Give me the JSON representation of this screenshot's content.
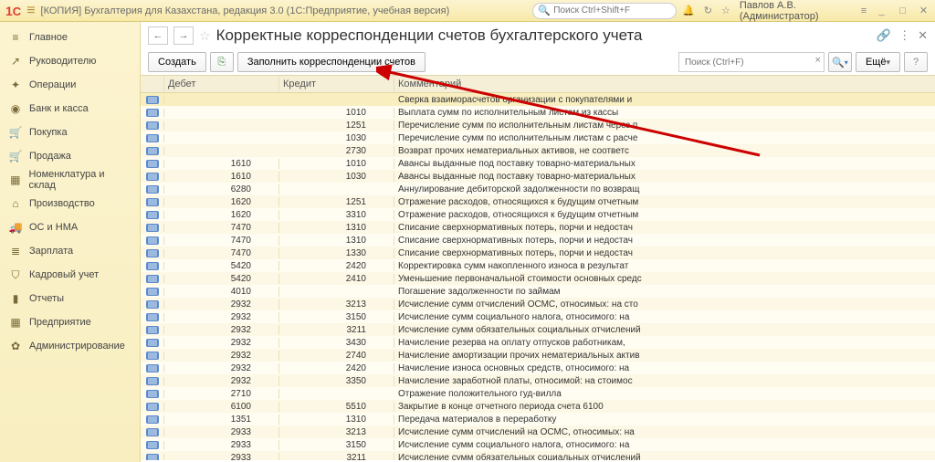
{
  "app_title": "[КОПИЯ] Бухгалтерия для Казахстана, редакция 3.0  (1С:Предприятие, учебная версия)",
  "top_search_placeholder": "Поиск Ctrl+Shift+F",
  "user": "Павлов А.В. (Администратор)",
  "sidebar": {
    "items": [
      {
        "icon": "≡",
        "label": "Главное"
      },
      {
        "icon": "↗",
        "label": "Руководителю"
      },
      {
        "icon": "✦",
        "label": "Операции"
      },
      {
        "icon": "◉",
        "label": "Банк и касса"
      },
      {
        "icon": "🛒",
        "label": "Покупка"
      },
      {
        "icon": "🛒",
        "label": "Продажа"
      },
      {
        "icon": "▦",
        "label": "Номенклатура и склад"
      },
      {
        "icon": "⌂",
        "label": "Производство"
      },
      {
        "icon": "🚚",
        "label": "ОС и НМА"
      },
      {
        "icon": "≣",
        "label": "Зарплата"
      },
      {
        "icon": "⛉",
        "label": "Кадровый учет"
      },
      {
        "icon": "▮",
        "label": "Отчеты"
      },
      {
        "icon": "▦",
        "label": "Предприятие"
      },
      {
        "icon": "✿",
        "label": "Администрирование"
      }
    ]
  },
  "page_title": "Корректные корреспонденции счетов бухгалтерского учета",
  "toolbar": {
    "create": "Создать",
    "fill": "Заполнить корреспонденции счетов",
    "search_placeholder": "Поиск (Ctrl+F)",
    "more": "Ещё"
  },
  "columns": {
    "debet": "Дебет",
    "credit": "Кредит",
    "comment": "Комментарий"
  },
  "rows": [
    {
      "d": "",
      "c": "",
      "m": "Сверка взаиморасчетов организации с покупателями и",
      "sel": true
    },
    {
      "d": "",
      "c": "1010",
      "m": "Выплата сумм по исполнительным листам из кассы"
    },
    {
      "d": "",
      "c": "1251",
      "m": "Перечисление сумм по исполнительным листам через п"
    },
    {
      "d": "",
      "c": "1030",
      "m": "Перечисление сумм по исполнительным листам с расче"
    },
    {
      "d": "",
      "c": "2730",
      "m": "Возврат прочих нематериальных активов, не соответс"
    },
    {
      "d": "1610",
      "c": "1010",
      "m": "Авансы выданные под поставку товарно-материальных"
    },
    {
      "d": "1610",
      "c": "1030",
      "m": "Авансы выданные под поставку товарно-материальных"
    },
    {
      "d": "6280",
      "c": "",
      "m": "Аннулирование дебиторской задолженности по возвращ"
    },
    {
      "d": "1620",
      "c": "1251",
      "m": "Отражение расходов, относящихся к будущим отчетным"
    },
    {
      "d": "1620",
      "c": "3310",
      "m": "Отражение расходов, относящихся к будущим отчетным"
    },
    {
      "d": "7470",
      "c": "1310",
      "m": "Списание сверхнормативных потерь, порчи и недостач"
    },
    {
      "d": "7470",
      "c": "1310",
      "m": "Списание сверхнормативных потерь, порчи и недостач"
    },
    {
      "d": "7470",
      "c": "1330",
      "m": "Списание сверхнормативных потерь, порчи и недостач"
    },
    {
      "d": "5420",
      "c": "2420",
      "m": "Корректировка сумм накопленного износа в результат"
    },
    {
      "d": "5420",
      "c": "2410",
      "m": "Уменьшение первоначальной стоимости основных средс"
    },
    {
      "d": "4010",
      "c": "",
      "m": "Погашение задолженности по займам"
    },
    {
      "d": "2932",
      "c": "3213",
      "m": "Исчисление сумм отчислений ОСМС, относимых: на сто"
    },
    {
      "d": "2932",
      "c": "3150",
      "m": "Исчисление сумм социального налога, относимого: на"
    },
    {
      "d": "2932",
      "c": "3211",
      "m": "Исчисление сумм обязательных социальных отчислений"
    },
    {
      "d": "2932",
      "c": "3430",
      "m": "Начисление резерва на оплату отпусков работникам,"
    },
    {
      "d": "2932",
      "c": "2740",
      "m": "Начисление амортизации прочих нематериальных актив"
    },
    {
      "d": "2932",
      "c": "2420",
      "m": "Начисление износа основных средств, относимого: на"
    },
    {
      "d": "2932",
      "c": "3350",
      "m": "Начисление заработной платы, относимой: на стоимос"
    },
    {
      "d": "2710",
      "c": "",
      "m": "Отражение положительного гуд-вилла"
    },
    {
      "d": "6100",
      "c": "5510",
      "m": "Закрытие в конце отчетного периода счета 6100"
    },
    {
      "d": "1351",
      "c": "1310",
      "m": "Передача материалов в переработку"
    },
    {
      "d": "2933",
      "c": "3213",
      "m": "Исчисление сумм отчислений на ОСМС, относимых: на"
    },
    {
      "d": "2933",
      "c": "3150",
      "m": "Исчисление сумм социального налога, относимого: на"
    },
    {
      "d": "2933",
      "c": "3211",
      "m": "Исчисление сумм обязательных социальных отчислений"
    }
  ]
}
